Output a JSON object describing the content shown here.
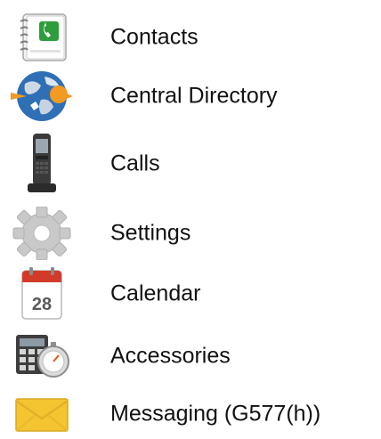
{
  "menu": {
    "items": [
      {
        "label": "Contacts",
        "icon": "address-book-icon"
      },
      {
        "label": "Central Directory",
        "icon": "globe-icon"
      },
      {
        "label": "Calls",
        "icon": "phone-icon"
      },
      {
        "label": "Settings",
        "icon": "gear-icon"
      },
      {
        "label": "Calendar",
        "icon": "calendar-icon",
        "date": "28"
      },
      {
        "label": "Accessories",
        "icon": "calculator-stopwatch-icon"
      },
      {
        "label": "Messaging (G577(h))",
        "icon": "envelope-icon"
      }
    ]
  },
  "colors": {
    "text": "#111111",
    "calendar_red": "#d23a2a",
    "envelope_yellow": "#f4c531",
    "globe_blue": "#2f6fb5",
    "globe_orange": "#f29a22"
  }
}
